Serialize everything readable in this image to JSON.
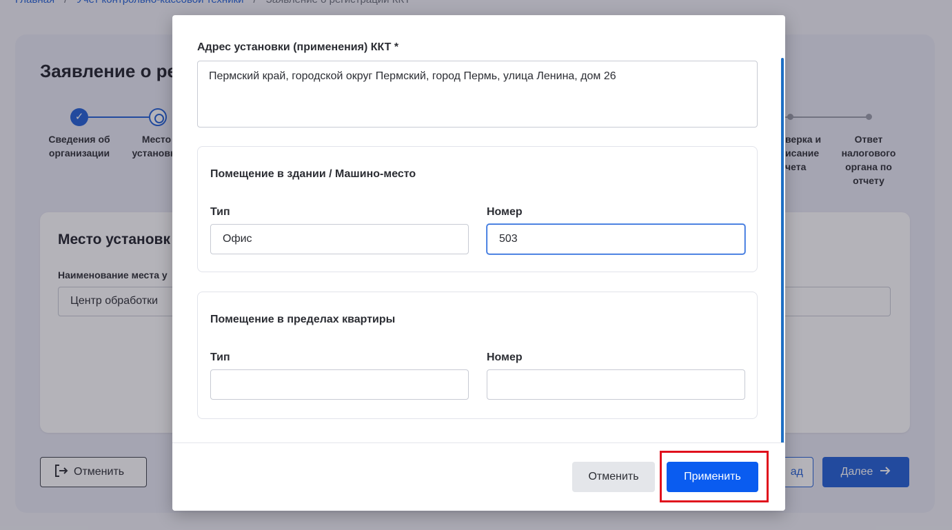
{
  "breadcrumb": {
    "items": [
      "Главная",
      "Учет контрольно-кассовой техники",
      "Заявление о регистрации ККТ"
    ]
  },
  "page": {
    "title": "Заявление о ре"
  },
  "stepper": {
    "steps": [
      {
        "label_l1": "Сведения об",
        "label_l2": "организации"
      },
      {
        "label_l1": "Место",
        "label_l2": "установки"
      },
      {
        "label_l1": "верка и",
        "label_l2": "исание",
        "label_l3": "чета"
      },
      {
        "label_l1": "Ответ",
        "label_l2": "налогового",
        "label_l3": "органа по",
        "label_l4": "отчету"
      }
    ]
  },
  "install_place": {
    "title": "Место установк",
    "name_label": "Наименование места у",
    "name_value": "Центр обработки"
  },
  "page_buttons": {
    "exit": "Отменить",
    "back": "ад",
    "next": "Далее"
  },
  "modal": {
    "address_label": "Адрес установки (применения) ККТ *",
    "address_value": "Пермский край, городской округ Пермский, город Пермь, улица Ленина, дом 26",
    "section_building": {
      "title": "Помещение в здании / Машино-место",
      "type_label": "Тип",
      "type_value": "Офис",
      "number_label": "Номер",
      "number_value": "503"
    },
    "section_apartment": {
      "title": "Помещение в пределах квартиры",
      "type_label": "Тип",
      "type_value": "",
      "number_label": "Номер",
      "number_value": ""
    },
    "cancel_label": "Отменить",
    "apply_label": "Применить"
  },
  "colors": {
    "accent": "#1f5fd6",
    "apply_button": "#0a5cf0",
    "highlight": "#e0101c"
  },
  "icons": {
    "check": "check-icon",
    "exit": "exit-icon",
    "arrow_right": "arrow-right-icon"
  }
}
